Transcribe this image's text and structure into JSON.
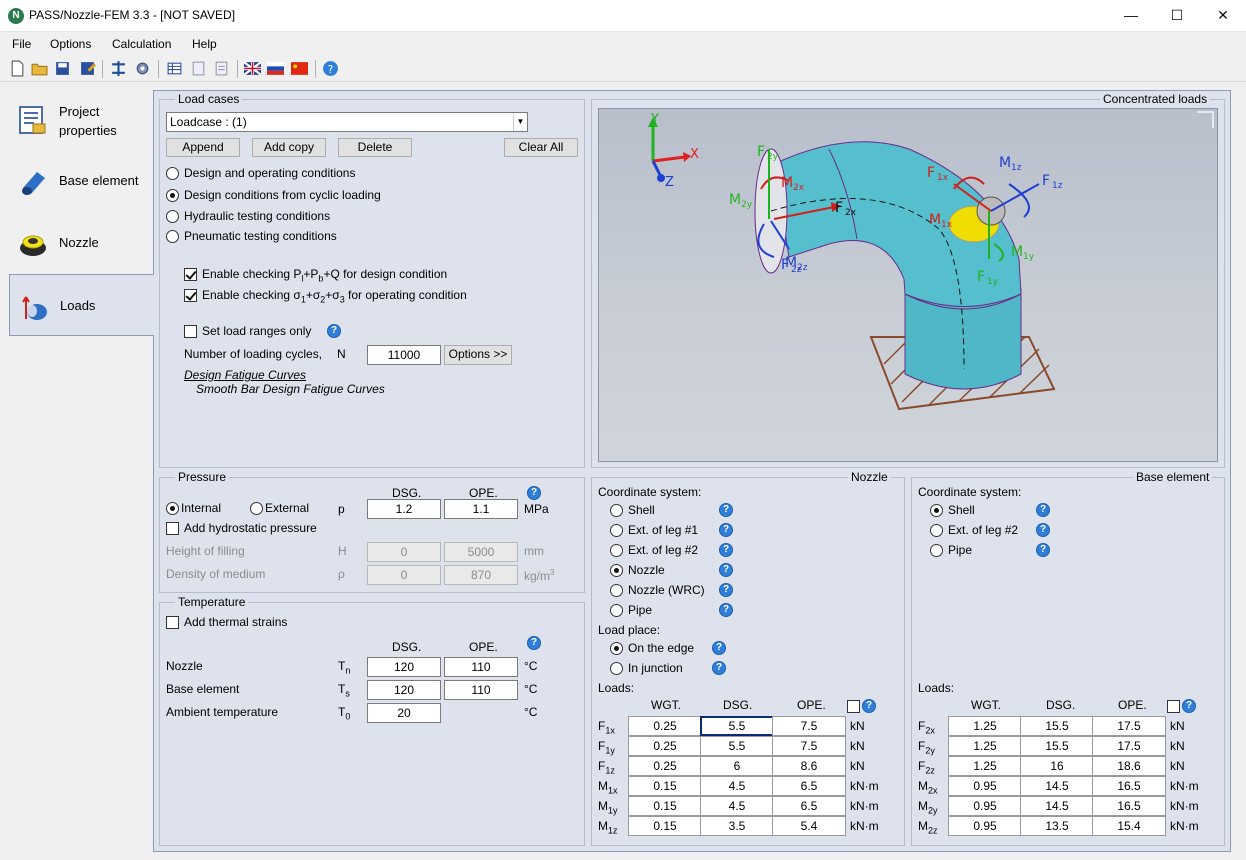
{
  "window": {
    "title": "PASS/Nozzle-FEM 3.3 - [NOT SAVED]",
    "app_icon": "N"
  },
  "menu": [
    "File",
    "Options",
    "Calculation",
    "Help"
  ],
  "nav": [
    {
      "label_line1": "Project",
      "label_line2": "properties"
    },
    {
      "label": "Base element"
    },
    {
      "label": "Nozzle"
    },
    {
      "label": "Loads"
    }
  ],
  "load_cases": {
    "title": "Load cases",
    "selected": "Loadcase : (1)",
    "buttons": {
      "append": "Append",
      "add_copy": "Add copy",
      "delete": "Delete",
      "clear_all": "Clear All"
    },
    "conditions": [
      {
        "label": "Design and operating conditions",
        "selected": false
      },
      {
        "label": "Design conditions from cyclic loading",
        "selected": true
      },
      {
        "label": "Hydraulic testing conditions",
        "selected": false
      },
      {
        "label": "Pneumatic testing conditions",
        "selected": false
      }
    ],
    "check1_pre": "Enable checking P",
    "check1_post": " for design condition",
    "check2_pre": "Enable checking σ",
    "check2_post": " for operating condition",
    "load_ranges": "Set load ranges only",
    "cycles_label": "Number of loading cycles,",
    "cycles_sym": "N",
    "cycles_value": "11000",
    "options_btn": "Options >>",
    "fatigue_link": "Design Fatigue Curves",
    "fatigue_value": "Smooth Bar Design Fatigue Curves"
  },
  "concentrated_title": "Concentrated loads",
  "pressure": {
    "title": "Pressure",
    "internal": "Internal",
    "external": "External",
    "sym": "p",
    "col_dsg": "DSG.",
    "col_ope": "OPE.",
    "dsg": "1.2",
    "ope": "1.1",
    "unit": "MPa",
    "hydro": "Add hydrostatic pressure",
    "height_label": "Height of filling",
    "height_sym": "H",
    "height_dsg": "0",
    "height_ope": "5000",
    "height_unit": "mm",
    "density_label": "Density of medium",
    "density_sym": "ρ",
    "density_dsg": "0",
    "density_ope": "870",
    "density_unit": "kg/m"
  },
  "temperature": {
    "title": "Temperature",
    "thermal": "Add thermal strains",
    "col_dsg": "DSG.",
    "col_ope": "OPE.",
    "rows": [
      {
        "label": "Nozzle",
        "sym": "T",
        "sub": "n",
        "dsg": "120",
        "ope": "110",
        "unit": "°C"
      },
      {
        "label": "Base element",
        "sym": "T",
        "sub": "s",
        "dsg": "120",
        "ope": "110",
        "unit": "°C"
      },
      {
        "label": "Ambient temperature",
        "sym": "T",
        "sub": "0",
        "dsg": "20",
        "ope": "",
        "unit": "°C"
      }
    ]
  },
  "nozzle": {
    "title": "Nozzle",
    "coord_label": "Coordinate system:",
    "coords": [
      {
        "label": "Shell",
        "selected": false
      },
      {
        "label": "Ext. of leg #1",
        "selected": false
      },
      {
        "label": "Ext. of leg #2",
        "selected": false
      },
      {
        "label": "Nozzle",
        "selected": true
      },
      {
        "label": "Nozzle (WRC)",
        "selected": false
      },
      {
        "label": "Pipe",
        "selected": false
      }
    ],
    "place_label": "Load place:",
    "places": [
      {
        "label": "On the edge",
        "selected": true
      },
      {
        "label": "In junction",
        "selected": false
      }
    ],
    "loads_label": "Loads:",
    "cols": [
      "WGT.",
      "DSG.",
      "OPE."
    ],
    "rows": [
      {
        "sym": "F",
        "sub": "1x",
        "wgt": "0.25",
        "dsg": "5.5",
        "ope": "7.5",
        "unit": "kN"
      },
      {
        "sym": "F",
        "sub": "1y",
        "wgt": "0.25",
        "dsg": "5.5",
        "ope": "7.5",
        "unit": "kN"
      },
      {
        "sym": "F",
        "sub": "1z",
        "wgt": "0.25",
        "dsg": "6",
        "ope": "8.6",
        "unit": "kN"
      },
      {
        "sym": "M",
        "sub": "1x",
        "wgt": "0.15",
        "dsg": "4.5",
        "ope": "6.5",
        "unit": "kN·m"
      },
      {
        "sym": "M",
        "sub": "1y",
        "wgt": "0.15",
        "dsg": "4.5",
        "ope": "6.5",
        "unit": "kN·m"
      },
      {
        "sym": "M",
        "sub": "1z",
        "wgt": "0.15",
        "dsg": "3.5",
        "ope": "5.4",
        "unit": "kN·m"
      }
    ]
  },
  "base_element": {
    "title": "Base element",
    "coord_label": "Coordinate system:",
    "coords": [
      {
        "label": "Shell",
        "selected": true
      },
      {
        "label": "Ext. of leg #2",
        "selected": false
      },
      {
        "label": "Pipe",
        "selected": false
      }
    ],
    "loads_label": "Loads:",
    "cols": [
      "WGT.",
      "DSG.",
      "OPE."
    ],
    "rows": [
      {
        "sym": "F",
        "sub": "2x",
        "wgt": "1.25",
        "dsg": "15.5",
        "ope": "17.5",
        "unit": "kN"
      },
      {
        "sym": "F",
        "sub": "2y",
        "wgt": "1.25",
        "dsg": "15.5",
        "ope": "17.5",
        "unit": "kN"
      },
      {
        "sym": "F",
        "sub": "2z",
        "wgt": "1.25",
        "dsg": "16",
        "ope": "18.6",
        "unit": "kN"
      },
      {
        "sym": "M",
        "sub": "2x",
        "wgt": "0.95",
        "dsg": "14.5",
        "ope": "16.5",
        "unit": "kN·m"
      },
      {
        "sym": "M",
        "sub": "2y",
        "wgt": "0.95",
        "dsg": "14.5",
        "ope": "16.5",
        "unit": "kN·m"
      },
      {
        "sym": "M",
        "sub": "2z",
        "wgt": "0.95",
        "dsg": "13.5",
        "ope": "15.4",
        "unit": "kN·m"
      }
    ]
  },
  "view3d": {
    "axes": {
      "x": "X",
      "y": "Y",
      "z": "Z"
    },
    "labels": {
      "f1x": "F",
      "f1y": "F",
      "f1z": "F",
      "m1x": "M",
      "m1y": "M",
      "m1z": "M",
      "f2x": "F",
      "f2y": "F",
      "f2z": "F",
      "m2x": "M",
      "m2y": "M",
      "m2z": "M"
    }
  }
}
